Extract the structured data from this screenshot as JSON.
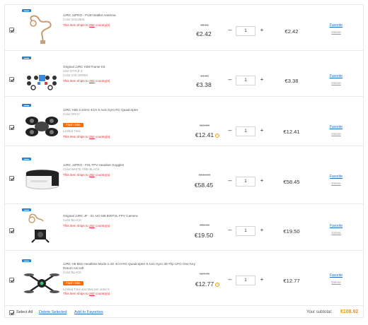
{
  "items": [
    {
      "title": "JJRC JJPRO - P130 Battler Antenna",
      "attrs": [
        "Color:GOLDEN"
      ],
      "flash": "",
      "limit": "",
      "ships_prefix": "This item ships to ",
      "ships_count": "262",
      "ships_suffix": " country(s)",
      "original_price": "€3.51",
      "price": "€2.42",
      "has_info_icon": false,
      "quantity": "1",
      "subtotal": "€2.42",
      "favorite": "Favorite",
      "delete": "Delete",
      "image": "antenna"
    },
    {
      "title": "Original JJRC H36 Frame Kit",
      "attrs": [
        "Size:STYLE 3",
        "Color:COLORMIX"
      ],
      "flash": "",
      "limit": "",
      "ships_prefix": "This item ships to ",
      "ships_count": "262",
      "ships_suffix": " country(s)",
      "original_price": "€4.68",
      "price": "€3.38",
      "has_info_icon": false,
      "quantity": "1",
      "subtotal": "€3.38",
      "favorite": "Favorite",
      "delete": "Delete",
      "image": "frame-kit"
    },
    {
      "title": "JJRC H36 2.4GHz 4CH 6 Axis Gyro RC Quadcopter",
      "attrs": [
        "Color:GRAY"
      ],
      "flash": "Flash Sale",
      "limit": "Limited Time",
      "ships_prefix": "This item ships to ",
      "ships_count": "262",
      "ships_suffix": " country(s)",
      "original_price": "€18.08",
      "price": "€12.41",
      "has_info_icon": true,
      "quantity": "1",
      "subtotal": "€12.41",
      "favorite": "Favorite",
      "delete": "Delete",
      "image": "quadcopter"
    },
    {
      "title": "JJRC JJPRO - F01 FPV Headset Goggles",
      "attrs": [
        "Color:WHITE AND BLACK"
      ],
      "flash": "",
      "limit": "",
      "ships_prefix": "This item ships to ",
      "ships_count": "262",
      "ships_suffix": " country(s)",
      "original_price": "€144.86",
      "price": "€58.45",
      "has_info_icon": false,
      "quantity": "1",
      "subtotal": "€58.45",
      "favorite": "Favorite",
      "delete": "Delete",
      "image": "goggles"
    },
    {
      "title": "Original JJRC JF - 01 AIO M8 800TVL FPV Camera",
      "attrs": [
        "Color:BLACK"
      ],
      "flash": "",
      "limit": "",
      "ships_prefix": "This item ships to ",
      "ships_count": "262",
      "ships_suffix": " country(s)",
      "original_price": "€32.15",
      "price": "€19.50",
      "has_info_icon": false,
      "quantity": "1",
      "subtotal": "€19.50",
      "favorite": "Favorite",
      "delete": "Delete",
      "image": "camera"
    },
    {
      "title": "JJRC H8 Mini Headless Mode 2.4G 4CH RC Quadcopter 6 Axis Gyro 3D Flip UFO One Key Return Aircraft",
      "attrs": [
        "Color:BLACK"
      ],
      "flash": "Flash Sale",
      "limit": "Limited Time and Max per order:5",
      "ships_prefix": "This item ships to ",
      "ships_count": "262",
      "ships_suffix": " country(s)",
      "original_price": "€17.78",
      "price": "€12.77",
      "has_info_icon": true,
      "quantity": "1",
      "subtotal": "€12.77",
      "favorite": "Favorite",
      "delete": "Delete",
      "image": "mini-quad"
    }
  ],
  "footer": {
    "select_all": "Select All",
    "delete_selected": "Delete Selected",
    "add_to_favorites": "Add to Favorites",
    "subtotal_label": "Your subtotal:",
    "subtotal_value": "€108.92"
  },
  "colors": {
    "accent_link": "#1a6bc4",
    "warning_red": "#e12d2d",
    "flash_orange": "#ff6a00",
    "total_orange": "#ff8a00"
  }
}
